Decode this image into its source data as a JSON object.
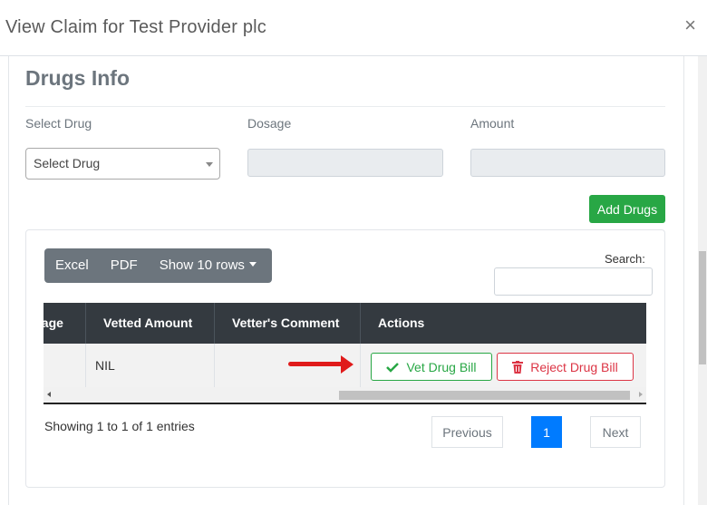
{
  "modal": {
    "title": "View Claim for Test Provider plc",
    "close_symbol": "×"
  },
  "section": {
    "title": "Drugs Info"
  },
  "form": {
    "select_drug_label": "Select Drug",
    "select_drug_value": "Select Drug",
    "dosage_label": "Dosage",
    "amount_label": "Amount",
    "add_button": "Add Drugs"
  },
  "toolbar": {
    "excel": "Excel",
    "pdf": "PDF",
    "show_rows": "Show 10 rows",
    "search_label": "Search:"
  },
  "table": {
    "headers": [
      "sage",
      "Vetted Amount",
      "Vetter's Comment",
      "Actions"
    ],
    "rows": [
      {
        "dosage": "",
        "vetted_amount": "NIL",
        "comment": ""
      }
    ],
    "vet_button": "Vet Drug Bill",
    "reject_button": "Reject Drug Bill"
  },
  "footer": {
    "info": "Showing 1 to 1 of 1 entries",
    "previous": "Previous",
    "page": "1",
    "next": "Next"
  },
  "colors": {
    "success": "#28a745",
    "danger": "#dc3545",
    "primary": "#007bff",
    "header_dark": "#343a40",
    "annotation_arrow": "#e01b1b"
  }
}
